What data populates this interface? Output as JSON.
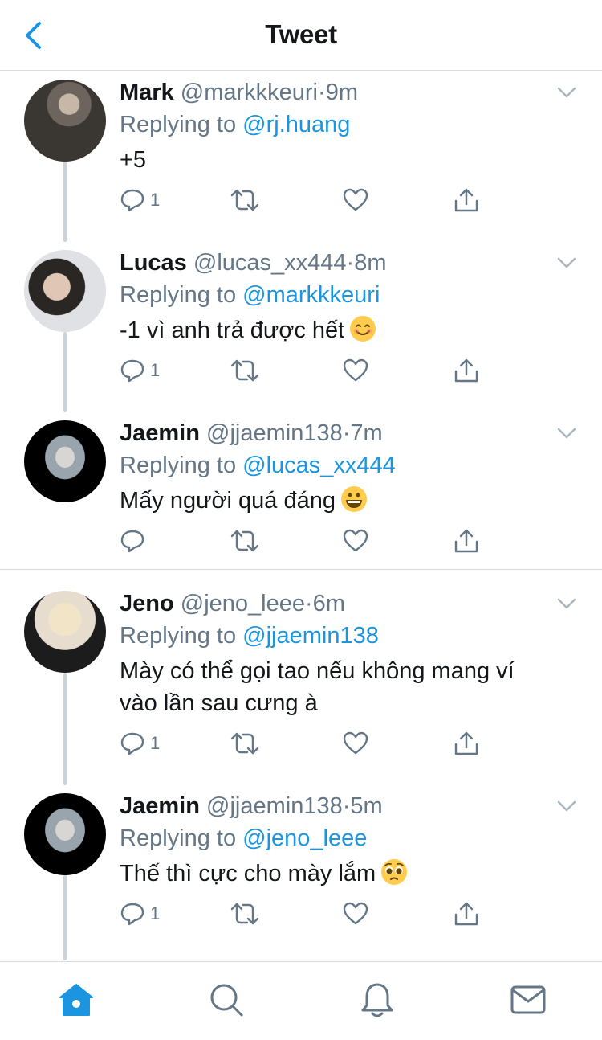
{
  "header": {
    "title": "Tweet"
  },
  "colors": {
    "accent": "#1b95e0",
    "secondary_text": "#657786",
    "divider": "#d9dde1",
    "thread_line": "#cbd3da"
  },
  "replying_prefix": "Replying to",
  "tweets": [
    {
      "name": "Mark",
      "handle": "@markkkeuri",
      "sep": "·",
      "time": "9m",
      "reply_to": "@rj.huang",
      "text": "+5",
      "reply_count": "1",
      "emoji": ""
    },
    {
      "name": "Lucas",
      "handle": "@lucas_xx444",
      "sep": "·",
      "time": "8m",
      "reply_to": "@markkkeuri",
      "text": "-1 vì anh trả được hết",
      "reply_count": "1",
      "emoji": "smiling-face"
    },
    {
      "name": "Jaemin",
      "handle": "@jjaemin138",
      "sep": "·",
      "time": "7m",
      "reply_to": "@lucas_xx444",
      "text": "Mấy người quá đáng",
      "reply_count": "",
      "emoji": "grinning-face"
    },
    {
      "name": "Jeno",
      "handle": "@jeno_leee",
      "sep": "·",
      "time": "6m",
      "reply_to": "@jjaemin138",
      "text": "Mày có thể gọi tao nếu không mang ví vào lần sau cưng à",
      "reply_count": "1",
      "emoji": ""
    },
    {
      "name": "Jaemin",
      "handle": "@jjaemin138",
      "sep": "·",
      "time": "5m",
      "reply_to": "@jeno_leee",
      "text": "Thế thì cực cho mày lắm",
      "reply_count": "1",
      "emoji": "pleading-face"
    }
  ],
  "tabs": [
    "home-icon",
    "search-icon",
    "notifications-icon",
    "messages-icon"
  ]
}
